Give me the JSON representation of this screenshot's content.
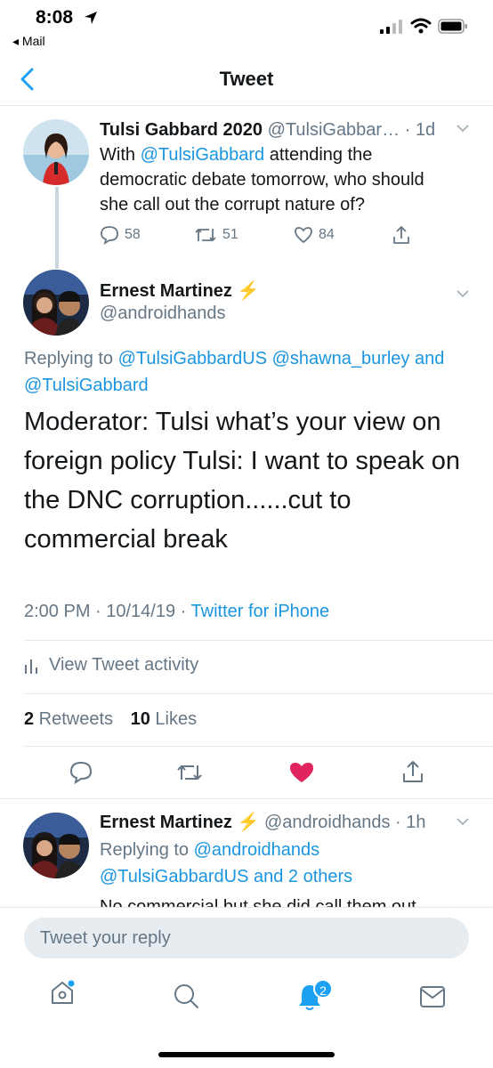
{
  "status_bar": {
    "time": "8:08",
    "back_app": "◂ Mail"
  },
  "nav": {
    "title": "Tweet"
  },
  "original_tweet": {
    "name": "Tulsi Gabbard 2020",
    "handle": "@TulsiGabbar…",
    "time": "· 1d",
    "text_line1_mention": "@TulsiGabbard",
    "text_line1_rest": " attending the",
    "text_line1_pre": "With ",
    "text_line2": "democratic debate tomorrow, who should",
    "text_line3": "she call out the corrupt nature of?",
    "replies": "58",
    "retweets": "51",
    "likes": "84"
  },
  "main_tweet": {
    "name": "Ernest Martinez",
    "name_emoji": "⚡",
    "handle": "@androidhands",
    "replying_prefix": "Replying to ",
    "replying_to_line1": "@TulsiGabbardUS @shawna_burley and",
    "replying_to_line2": "@TulsiGabbard",
    "text": "Moderator: Tulsi what’s your view on foreign policy  Tulsi: I want to speak on the DNC corruption......cut to commercial break",
    "timestamp": "2:00 PM · 10/14/19 · ",
    "source": "Twitter for iPhone",
    "activity_label": "View Tweet activity",
    "retweet_count": "2",
    "retweet_label": " Retweets",
    "like_count": "10",
    "like_label": " Likes"
  },
  "reply_tweet": {
    "name": "Ernest Martinez",
    "name_emoji": "⚡",
    "handle": "@androidhands",
    "time": "· 1h",
    "replying_prefix": "Replying to ",
    "replying_to_line1": "@androidhands",
    "replying_to_line2": "@TulsiGabbardUS and 2 others",
    "text_partial": "No commercial but she did call them out"
  },
  "compose": {
    "placeholder": "Tweet your reply"
  },
  "tab_bar": {
    "notification_badge": "2"
  },
  "colors": {
    "accent": "#1da1f2",
    "link": "#1b95e0",
    "like_active": "#e0245e"
  }
}
